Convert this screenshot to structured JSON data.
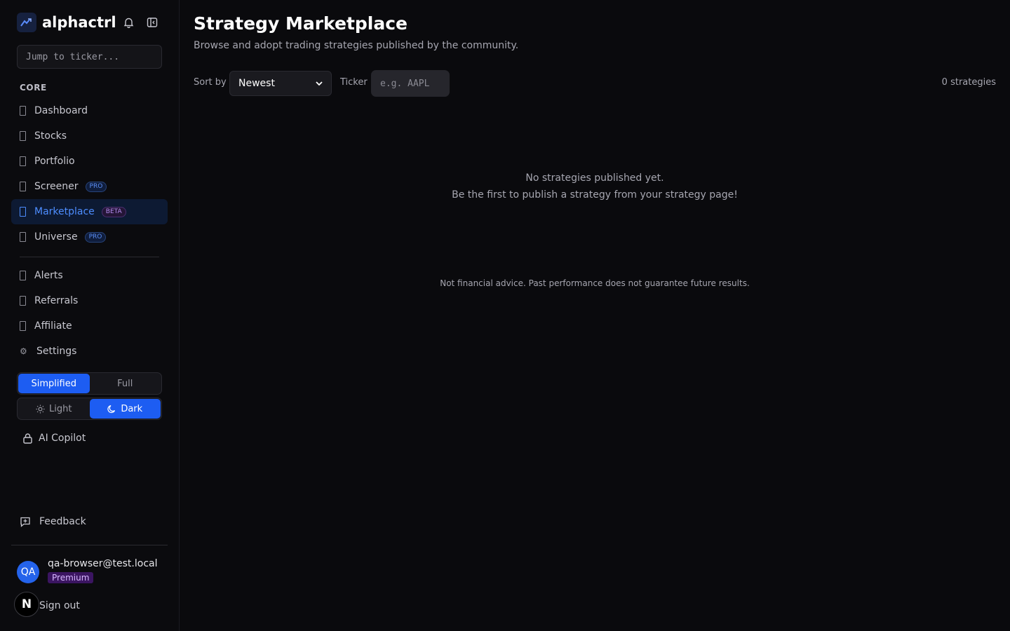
{
  "brand": {
    "name": "alphactrl"
  },
  "search": {
    "placeholder": "Jump to ticker..."
  },
  "sidebar": {
    "section_core": "CORE",
    "core_items": [
      {
        "label": "Dashboard"
      },
      {
        "label": "Stocks"
      },
      {
        "label": "Portfolio"
      },
      {
        "label": "Screener",
        "badge": "PRO"
      },
      {
        "label": "Marketplace",
        "badge": "BETA",
        "active": true
      },
      {
        "label": "Universe",
        "badge": "PRO"
      }
    ],
    "other_items": [
      {
        "label": "Alerts"
      },
      {
        "label": "Referrals"
      },
      {
        "label": "Affiliate"
      },
      {
        "label": "Settings"
      }
    ],
    "view_mode": {
      "simplified": "Simplified",
      "full": "Full",
      "selected": "Simplified"
    },
    "theme": {
      "light": "Light",
      "dark": "Dark",
      "selected": "Dark"
    },
    "ai_copilot": "AI Copilot",
    "feedback": "Feedback",
    "user": {
      "initials": "QA",
      "email": "qa-browser@test.local",
      "plan": "Premium"
    },
    "signout": "Sign out",
    "n_badge": "N"
  },
  "main": {
    "title": "Strategy Marketplace",
    "subtitle": "Browse and adopt trading strategies published by the community.",
    "sort_label": "Sort by",
    "sort_value": "Newest",
    "ticker_label": "Ticker",
    "ticker_placeholder": "e.g. AAPL",
    "count": "0 strategies",
    "empty_line1": "No strategies published yet.",
    "empty_line2": "Be the first to publish a strategy from your strategy page!",
    "disclaimer": "Not financial advice. Past performance does not guarantee future results."
  },
  "colors": {
    "accent": "#1d5df2",
    "active_text": "#4d8dff",
    "premium_bg": "#3b1561"
  }
}
